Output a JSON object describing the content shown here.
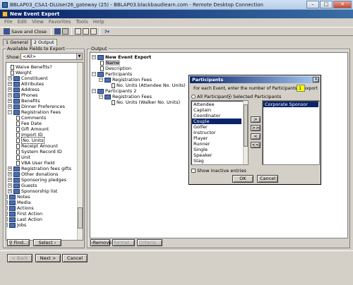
{
  "rdp": {
    "title": "BBLAP03_CSA1-DLUser26_gateway (25) - BBLAP03.blackbaudlearn.com - Remote Desktop Connection",
    "btn_min": "–",
    "btn_max": "□",
    "btn_close": "✕"
  },
  "app": {
    "title": "New Event Export",
    "btn_min": "–",
    "btn_max": "□",
    "btn_close": "✕"
  },
  "menu": [
    "File",
    "Edit",
    "View",
    "Favorites",
    "Tools",
    "Help"
  ],
  "toolbar": {
    "save_close": "Save and Close",
    "help_arrow": "?▾"
  },
  "tabs": {
    "general": "1 General",
    "output": "2 Output"
  },
  "left": {
    "group_label": "Available Fields to Export",
    "show_label": "Show:",
    "show_value": "<All>",
    "tree": [
      "Waive Benefits?",
      "Weight",
      "Constituent",
      "Attributes",
      "Address",
      "Phones",
      "Benefits",
      "Dinner Preferences",
      "Registration Fees",
      "Comments",
      "Fee Date",
      "Gift Amount",
      "Import ID",
      "No. Units",
      "Receipt Amount",
      "System Record ID",
      "Unit",
      "VBA User Field",
      "Registration fees gifts",
      "Other donations",
      "Sponsoring pledges",
      "Guests",
      "Sponsorship list",
      "Notes",
      "Media",
      "Actions",
      "First Action",
      "Last Action",
      "Jobs"
    ],
    "find_btn": "Find...",
    "select_btn": "Select ›"
  },
  "right": {
    "group_label": "Output",
    "tree": [
      "New Event Export",
      "Name",
      "Description",
      "Participants",
      "Registration Fees",
      "No. Units (Attendee No. Units)",
      "Participants 2",
      "Registration Fees",
      "No. Units (Walker No. Units)"
    ],
    "remove_btn": "‹Remove",
    "format_btn": "Format...",
    "criteria_btn": "Criteria..."
  },
  "dialog": {
    "title": "Participants",
    "close": "✕",
    "prompt": "For each Event, enter the number of Participants to export",
    "count_value": "1",
    "radio_all": "All Participants",
    "radio_selected": "Selected Participants",
    "available": [
      "Attendee",
      "Captain",
      "Coordinator",
      "Couple",
      "Golfer",
      "Instructor",
      "Player",
      "Runner",
      "Single",
      "Speaker",
      "Stag"
    ],
    "selected": [
      "Corporate Sponsor"
    ],
    "btn_add": ">",
    "btn_add_all": ">>",
    "btn_remove": "<",
    "btn_remove_all": "<<",
    "show_inactive": "Show inactive entries",
    "ok": "OK",
    "cancel": "Cancel"
  },
  "footer": {
    "back": "< Back",
    "next": "Next >",
    "cancel": "Cancel"
  },
  "colors": {
    "selection": "#0a246a",
    "highlight_input": "#ffff00",
    "desktop": "#3a6ea5"
  }
}
